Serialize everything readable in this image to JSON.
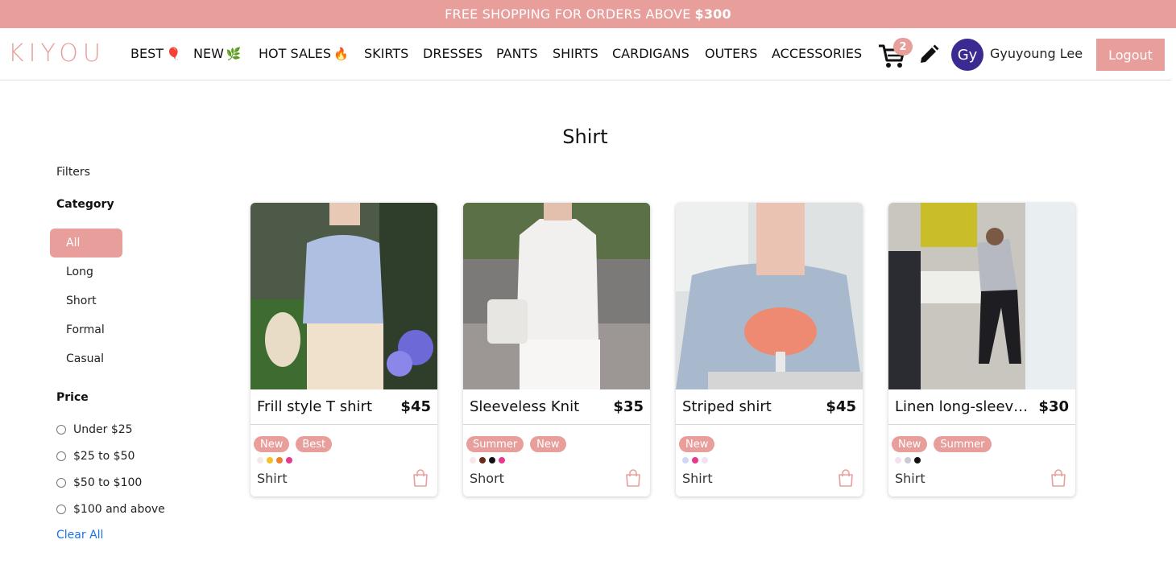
{
  "banner": {
    "text": "FREE SHOPPING FOR ORDERS ABOVE",
    "amount": "$300"
  },
  "brand": {
    "logo": "KIYOU",
    "accent": "#e89f9b"
  },
  "nav": {
    "items": [
      "BEST",
      "NEW",
      "HOT SALES",
      "SKIRTS",
      "DRESSES",
      "PANTS",
      "SHIRTS",
      "CARDIGANS",
      "OUTERS",
      "ACCESSORIES"
    ],
    "emoji": {
      "best": "🎈",
      "new": "🌿",
      "hot": "🔥"
    },
    "cart_count": "2",
    "avatar_initials": "Gy",
    "username": "Gyuyoung Lee",
    "logout_label": "Logout"
  },
  "page": {
    "title": "Shirt"
  },
  "filters": {
    "label": "Filters",
    "category_heading": "Category",
    "categories": [
      "All",
      "Long",
      "Short",
      "Formal",
      "Casual"
    ],
    "selected_category": "All",
    "price_heading": "Price",
    "prices": [
      "Under $25",
      "$25 to $50",
      "$50 to $100",
      "$100 and above"
    ],
    "clear_label": "Clear All"
  },
  "products": [
    {
      "name": "Frill style T shirt",
      "price": "$45",
      "tags": [
        "New",
        "Best"
      ],
      "colors": [
        "#f5e8e6",
        "#f5c026",
        "#f07f2e",
        "#e8398e"
      ],
      "category": "Shirt"
    },
    {
      "name": "Sleeveless Knit",
      "price": "$35",
      "tags": [
        "Summer",
        "New"
      ],
      "colors": [
        "#f5e8e6",
        "#6b2a1a",
        "#111111",
        "#e8398e"
      ],
      "category": "Short"
    },
    {
      "name": "Striped shirt",
      "price": "$45",
      "tags": [
        "New"
      ],
      "colors": [
        "#cdd8f5",
        "#e8398e",
        "#f3e0f0"
      ],
      "category": "Shirt"
    },
    {
      "name": "Linen long-sleeve shirt",
      "price": "$30",
      "tags": [
        "New",
        "Summer"
      ],
      "colors": [
        "#f3e0f0",
        "#c9c9d6",
        "#111111"
      ],
      "category": "Shirt"
    }
  ]
}
